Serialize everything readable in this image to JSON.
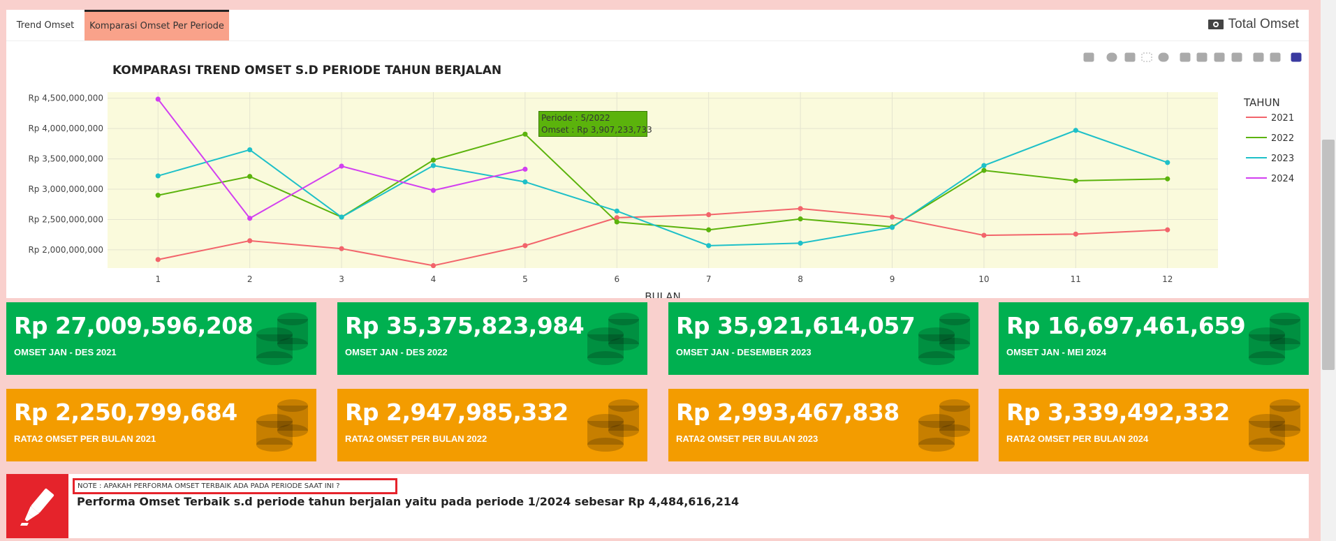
{
  "tabs": [
    {
      "label": "Trend Omset"
    },
    {
      "label": "Komparasi Omset Per Periode"
    }
  ],
  "header": {
    "total_title": "Total Omset"
  },
  "toolbar": {
    "icons": [
      "camera-icon",
      "zoom-icon",
      "pan-icon",
      "box-select-icon",
      "lasso-icon",
      "zoom-in-icon",
      "zoom-out-icon",
      "autoscale-icon",
      "reset-axes-icon",
      "spike-lines-icon",
      "compare-hover-icon",
      "plotly-logo-icon"
    ]
  },
  "tooltip": {
    "line1": "Periode : 5/2022",
    "line2": "Omset : Rp 3,907,233,733"
  },
  "chart_data": {
    "type": "line",
    "title": "KOMPARASI TREND OMSET S.D PERIODE TAHUN BERJALAN",
    "xlabel": "BULAN",
    "ylabel": "",
    "legend_title": "TAHUN",
    "legend_position": "right",
    "x": [
      1,
      2,
      3,
      4,
      5,
      6,
      7,
      8,
      9,
      10,
      11,
      12
    ],
    "ylim": [
      1700000000,
      4600000000
    ],
    "yticks": [
      2000000000,
      2500000000,
      3000000000,
      3500000000,
      4000000000,
      4500000000
    ],
    "ytick_labels": [
      "Rp 2,000,000,000",
      "Rp 2,500,000,000",
      "Rp 3,000,000,000",
      "Rp 3,500,000,000",
      "Rp 4,000,000,000",
      "Rp 4,500,000,000"
    ],
    "plot_bg": "#fafadc",
    "series": [
      {
        "name": "2021",
        "color": "#f2646b",
        "values": [
          1840000000,
          2150000000,
          2020000000,
          1740000000,
          2070000000,
          2530000000,
          2580000000,
          2680000000,
          2540000000,
          2240000000,
          2260000000,
          2330000000
        ]
      },
      {
        "name": "2022",
        "color": "#5bb30c",
        "values": [
          2900000000,
          3210000000,
          2540000000,
          3480000000,
          3907233733,
          2460000000,
          2330000000,
          2510000000,
          2380000000,
          3310000000,
          3140000000,
          3170000000
        ]
      },
      {
        "name": "2023",
        "color": "#1ec0c8",
        "values": [
          3220000000,
          3650000000,
          2540000000,
          3390000000,
          3120000000,
          2640000000,
          2070000000,
          2110000000,
          2370000000,
          3390000000,
          3970000000,
          3440000000
        ]
      },
      {
        "name": "2024",
        "color": "#d23ff0",
        "values": [
          4484616214,
          2520000000,
          3380000000,
          2980000000,
          3330000000
        ]
      }
    ]
  },
  "cards_total": [
    {
      "value": "Rp 27,009,596,208",
      "label": "OMSET JAN - DES 2021"
    },
    {
      "value": "Rp 35,375,823,984",
      "label": "OMSET JAN - DES 2022"
    },
    {
      "value": "Rp 35,921,614,057",
      "label": "OMSET JAN - DESEMBER 2023"
    },
    {
      "value": "Rp 16,697,461,659",
      "label": "OMSET JAN - MEI 2024"
    }
  ],
  "cards_avg": [
    {
      "value": "Rp 2,250,799,684",
      "label": "RATA2 OMSET PER BULAN 2021"
    },
    {
      "value": "Rp 2,947,985,332",
      "label": "RATA2 OMSET PER BULAN 2022"
    },
    {
      "value": "Rp 2,993,467,838",
      "label": "RATA2 OMSET PER BULAN 2023"
    },
    {
      "value": "Rp 3,339,492,332",
      "label": "RATA2 OMSET PER BULAN 2024"
    }
  ],
  "colors": {
    "green": "#00b050",
    "orange": "#f39c00",
    "red": "#e5232b",
    "tab_active": "#f9a28a"
  },
  "note": {
    "label": "NOTE : APAKAH PERFORMA OMSET TERBAIK ADA PADA PERIODE SAAT INI ?",
    "text": "Performa Omset Terbaik s.d periode tahun berjalan yaitu pada periode 1/2024 sebesar Rp 4,484,616,214"
  }
}
